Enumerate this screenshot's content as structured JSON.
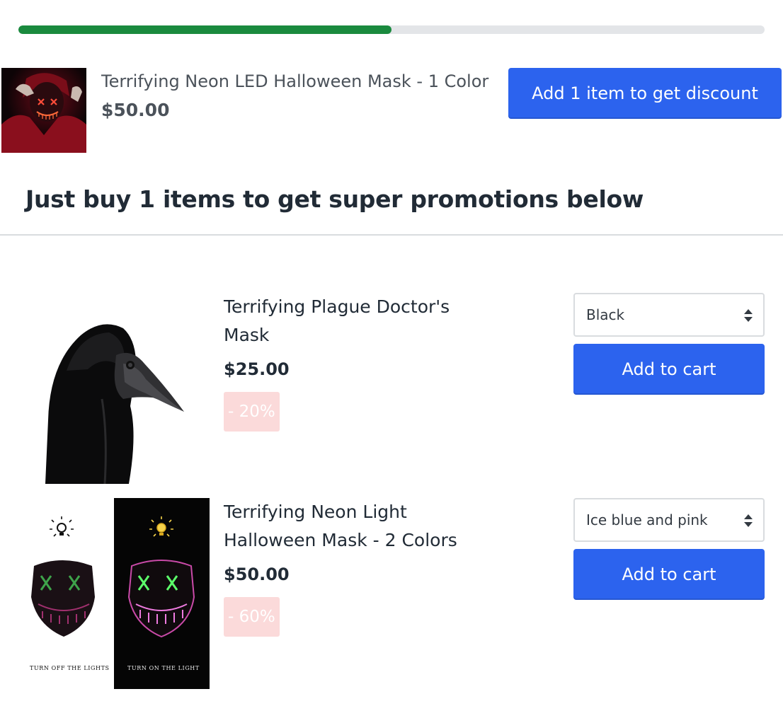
{
  "progress": {
    "fraction": 0.5,
    "fill_color": "#1a8a3e",
    "track_color": "#e3e5e8"
  },
  "current_item": {
    "image_icon": "neon-led-mask-photo",
    "title": "Terrifying Neon LED Halloween Mask - 1 Color",
    "price": "$50.00",
    "button_label": "Add 1 item to get discount"
  },
  "promo": {
    "heading": "Just buy 1 items to get super promotions below"
  },
  "products": [
    {
      "image_icon": "plague-doctor-mask-photo",
      "title": "Terrifying Plague Doctor's Mask",
      "price": "$25.00",
      "badge": "- 20%",
      "select_value": "Black",
      "cart_label": "Add to cart"
    },
    {
      "image_icon": "neon-light-mask-photo",
      "title": "Terrifying Neon Light Halloween Mask - 2 Colors",
      "price": "$50.00",
      "badge": "- 60%",
      "select_value": "Ice blue and pink",
      "cart_label": "Add to cart",
      "image_captions": [
        "TURN OFF THE LIGHTS",
        "TURN ON THE LIGHT"
      ]
    }
  ],
  "colors": {
    "primary_button": "#2c63ee",
    "badge_bg": "#fbdada",
    "text": "#212b36"
  }
}
